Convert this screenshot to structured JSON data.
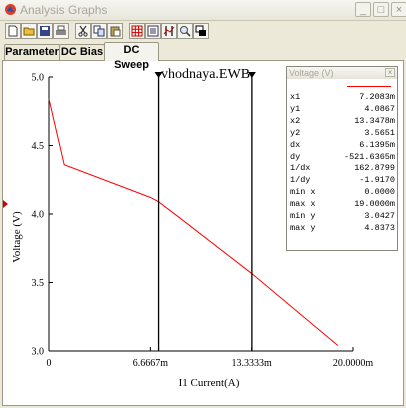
{
  "window": {
    "title": "Analysis Graphs",
    "min_glyph": "_",
    "max_glyph": "□",
    "close_glyph": "×"
  },
  "toolbar": {
    "buttons": [
      "new",
      "open",
      "save",
      "print",
      "cut",
      "copy",
      "paste",
      "grid",
      "legend",
      "cursors",
      "zoom",
      "view"
    ]
  },
  "tabs": [
    "Parameter",
    "DC Bias",
    "DC Sweep"
  ],
  "active_tab": "DC Sweep",
  "graph": {
    "title": "vhodnaya.EWB"
  },
  "chart_data": {
    "type": "line",
    "title": "vhodnaya.EWB",
    "xlabel": "I1 Current(A)",
    "ylabel": "Voltage (V)",
    "xlim": [
      0,
      0.02
    ],
    "ylim": [
      3.0,
      5.0
    ],
    "x_ticks": [
      0,
      0.0066667,
      0.0133333,
      0.02
    ],
    "x_tick_labels": [
      "0",
      "6.6667m",
      "13.3333m",
      "20.0000m"
    ],
    "y_ticks": [
      3.0,
      3.5,
      4.0,
      4.5,
      5.0
    ],
    "y_tick_labels": [
      "3.0",
      "3.5",
      "4.0",
      "4.5",
      "5.0"
    ],
    "series": [
      {
        "color": "#ff0000",
        "x": [
          0,
          0.001,
          0.0067,
          0.0072,
          0.0085,
          0.0134,
          0.019
        ],
        "y": [
          4.84,
          4.36,
          4.12,
          4.09,
          3.98,
          3.56,
          3.04
        ]
      }
    ],
    "cursors": [
      0.0072083,
      0.0133478
    ],
    "grid": false
  },
  "legend": {
    "title": "Voltage (V)",
    "close_glyph": "×",
    "rows": [
      {
        "k": "x1",
        "v": "7.2083m"
      },
      {
        "k": "y1",
        "v": "4.0867"
      },
      {
        "k": "x2",
        "v": "13.3478m"
      },
      {
        "k": "y2",
        "v": "3.5651"
      },
      {
        "k": "dx",
        "v": "6.1395m"
      },
      {
        "k": "dy",
        "v": "-521.6365m"
      },
      {
        "k": "1/dx",
        "v": "162.8799"
      },
      {
        "k": "1/dy",
        "v": "-1.9170"
      },
      {
        "k": "min x",
        "v": "0.0000"
      },
      {
        "k": "max x",
        "v": "19.0000m"
      },
      {
        "k": "min y",
        "v": "3.0427"
      },
      {
        "k": "max y",
        "v": "4.8373"
      }
    ]
  }
}
